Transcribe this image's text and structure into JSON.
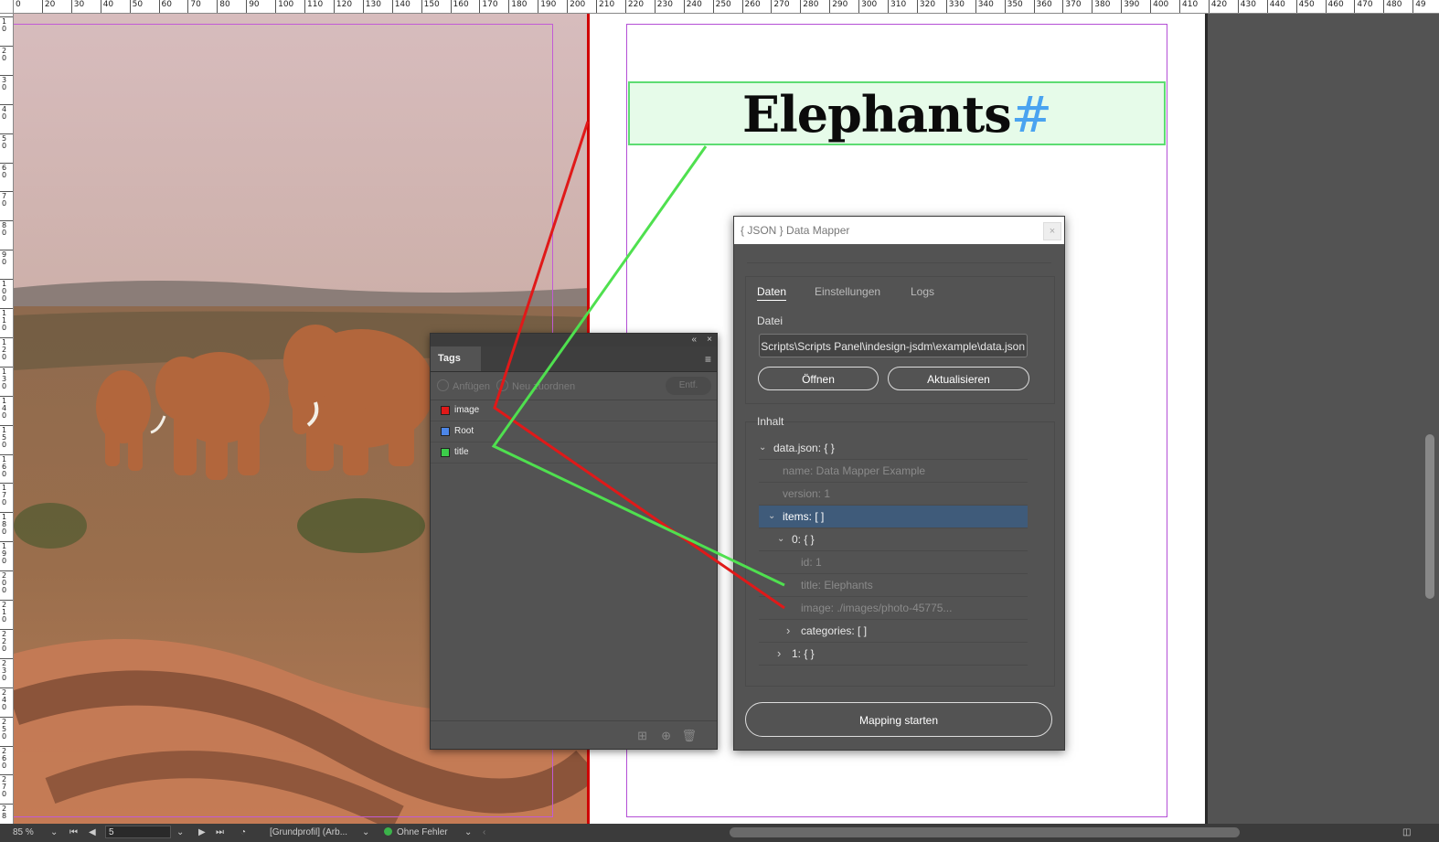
{
  "ruler": {
    "top_labels": [
      "0",
      "20",
      "30",
      "40",
      "50",
      "60",
      "70",
      "80",
      "90",
      "100",
      "110",
      "120",
      "130",
      "140",
      "150",
      "160",
      "170",
      "180",
      "190",
      "200",
      "210",
      "220",
      "230",
      "240",
      "250",
      "260",
      "270",
      "280",
      "290",
      "300",
      "310",
      "320",
      "330",
      "340",
      "350",
      "360",
      "370",
      "380",
      "390",
      "400",
      "410",
      "420",
      "430",
      "440",
      "450",
      "460",
      "470",
      "480",
      "49"
    ],
    "left_labels": [
      "10",
      "20",
      "30",
      "40",
      "50",
      "60",
      "70",
      "80",
      "90",
      "100",
      "110",
      "120",
      "130",
      "140",
      "150",
      "160",
      "170",
      "180",
      "190",
      "200",
      "210",
      "220",
      "230",
      "240",
      "250",
      "260",
      "270",
      "28"
    ]
  },
  "document": {
    "title_text": "Elephants",
    "title_marker": "#"
  },
  "tags_panel": {
    "collapse_icon": "«",
    "close_icon": "×",
    "tab_label": "Tags",
    "menu_icon": "≡",
    "toolbar": {
      "append_label": "Anfügen",
      "reorder_label": "Neu zuordnen",
      "remove_label": "Entf."
    },
    "tags": [
      {
        "label": "image",
        "color": "#e01919"
      },
      {
        "label": "Root",
        "color": "#4c86e8"
      },
      {
        "label": "title",
        "color": "#3ccc4a"
      }
    ]
  },
  "data_mapper": {
    "title": "{ JSON } Data Mapper",
    "close_icon": "×",
    "tabs": [
      "Daten",
      "Einstellungen",
      "Logs"
    ],
    "active_tab": "Daten",
    "file_section_label": "Datei",
    "file_path": "Scripts\\Scripts Panel\\indesign-jsdm\\example\\data.json",
    "open_button": "Öffnen",
    "refresh_button": "Aktualisieren",
    "content_section_label": "Inhalt",
    "tree": [
      {
        "caret": "⌄",
        "text": "data.json: { }"
      },
      {
        "caret": "",
        "text": "name: Data Mapper Example"
      },
      {
        "caret": "",
        "text": "version: 1"
      },
      {
        "caret": "⌄",
        "text": "items: [ ]"
      },
      {
        "caret": "⌄",
        "text": "0: { }"
      },
      {
        "caret": "",
        "text": "id: 1"
      },
      {
        "caret": "",
        "text": "title: Elephants"
      },
      {
        "caret": "",
        "text": "image: ./images/photo-45775..."
      },
      {
        "caret": "›",
        "text": "categories: [ ]"
      },
      {
        "caret": "›",
        "text": "1: { }"
      }
    ],
    "start_button": "Mapping starten"
  },
  "status_bar": {
    "zoom": "85 %",
    "page": "5",
    "profile": "[Grundprofil] (Arb...",
    "preflight": "Ohne Fehler"
  },
  "colors": {
    "image_link": "#e01919",
    "title_link": "#4fe04f",
    "selection": "#3f5b7a"
  }
}
